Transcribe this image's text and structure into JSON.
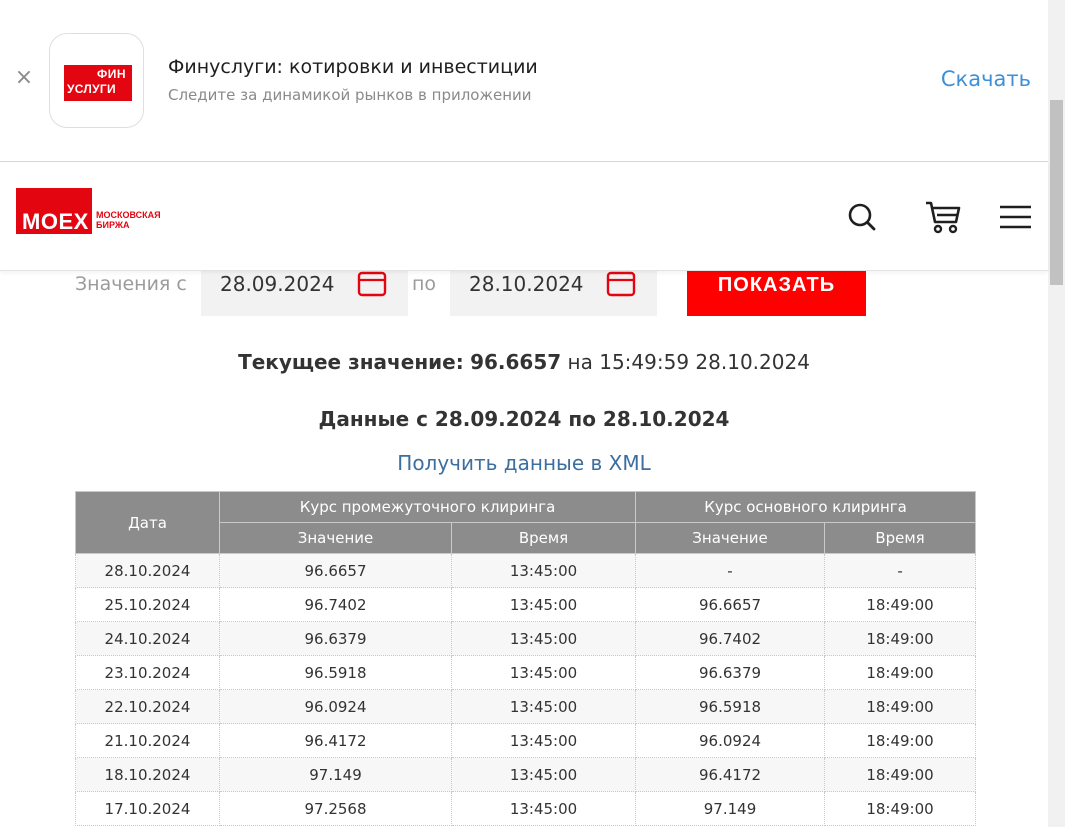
{
  "banner": {
    "close_glyph": "×",
    "app_logo_line1": "ФИН",
    "app_logo_line2": "УСЛУГИ",
    "title": "Финуслуги: котировки и инвестиции",
    "subtitle": "Следите за динамикой рынков в приложении",
    "download_label": "Скачать"
  },
  "header": {
    "logo_text": "MOEX",
    "logo_side_line1": "МОСКОВСКАЯ",
    "logo_side_line2": "БИРЖА",
    "icons": [
      "search-icon",
      "cart-icon",
      "menu-icon"
    ]
  },
  "filter": {
    "from_label": "Значения с",
    "from_value": "28.09.2024",
    "to_label": "по",
    "to_value": "28.10.2024",
    "show_button": "ПОКАЗАТЬ"
  },
  "current": {
    "label": "Текущее значение:",
    "value": "96.6657",
    "at_label": "на",
    "timestamp": "15:49:59 28.10.2024"
  },
  "period_title": "Данные с 28.09.2024 по 28.10.2024",
  "xml_link": "Получить данные в XML",
  "table": {
    "col_date": "Дата",
    "group_intermediate": "Курс промежуточного клиринга",
    "group_main": "Курс основного клиринга",
    "col_value": "Значение",
    "col_time": "Время",
    "rows": [
      [
        "28.10.2024",
        "96.6657",
        "13:45:00",
        "-",
        "-"
      ],
      [
        "25.10.2024",
        "96.7402",
        "13:45:00",
        "96.6657",
        "18:49:00"
      ],
      [
        "24.10.2024",
        "96.6379",
        "13:45:00",
        "96.7402",
        "18:49:00"
      ],
      [
        "23.10.2024",
        "96.5918",
        "13:45:00",
        "96.6379",
        "18:49:00"
      ],
      [
        "22.10.2024",
        "96.0924",
        "13:45:00",
        "96.5918",
        "18:49:00"
      ],
      [
        "21.10.2024",
        "96.4172",
        "13:45:00",
        "96.0924",
        "18:49:00"
      ],
      [
        "18.10.2024",
        "97.149",
        "13:45:00",
        "96.4172",
        "18:49:00"
      ],
      [
        "17.10.2024",
        "97.2568",
        "13:45:00",
        "97.149",
        "18:49:00"
      ]
    ]
  },
  "colors": {
    "brand_red": "#e30611",
    "button_red": "#ff0000",
    "link_blue": "#3c6e9f",
    "download_blue": "#3d8fd8",
    "table_header": "#8c8c8c"
  }
}
